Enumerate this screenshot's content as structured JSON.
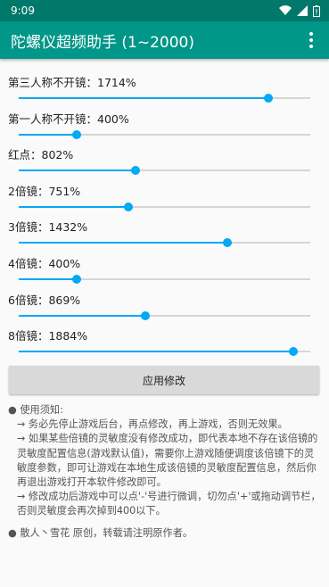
{
  "status": {
    "time": "9:09"
  },
  "app": {
    "title": "陀螺仪超频助手 (1~2000)"
  },
  "slider_max": 2000,
  "sliders": [
    {
      "label": "第三人称不开镜：1714%",
      "value": 1714
    },
    {
      "label": "第一人称不开镜：400%",
      "value": 400
    },
    {
      "label": "红点：802%",
      "value": 802
    },
    {
      "label": "2倍镜：751%",
      "value": 751
    },
    {
      "label": "3倍镜：1432%",
      "value": 1432
    },
    {
      "label": "4倍镜：400%",
      "value": 400
    },
    {
      "label": "6倍镜：869%",
      "value": 869
    },
    {
      "label": "8倍镜：1884%",
      "value": 1884
    }
  ],
  "apply_button": "应用修改",
  "notes": {
    "heading": "● 使用须知:",
    "item1": "→ 务必先停止游戏后台，再点修改，再上游戏，否则无效果。",
    "item2": "→ 如果某些倍镜的灵敏度没有修改成功，即代表本地不存在该倍镜的灵敏度配置信息(游戏默认值)，需要你上游戏随便调度该倍镜下的灵敏度参数，即可让游戏在本地生成该倍镜的灵敏度配置信息，然后你再退出游戏打开本软件修改即可。",
    "item3": "→ 修改成功后游戏中可以点'-'号进行微调，切勿点'+'或拖动调节栏，否则灵敏度会再次掉到400以下。"
  },
  "credit": "● 散人丶雪花 原创，转载请注明原作者。",
  "colors": {
    "status_bar": "#00796b",
    "app_bar": "#009688",
    "slider_accent": "#03a9f4"
  }
}
